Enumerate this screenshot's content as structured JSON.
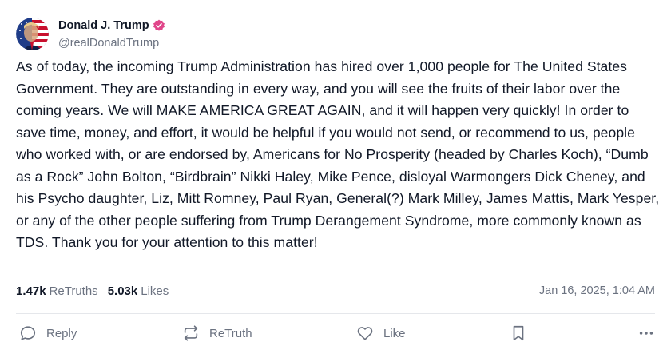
{
  "author": {
    "display_name": "Donald J. Trump",
    "handle": "@realDonaldTrump",
    "verified_color": "#e0468a"
  },
  "post": {
    "text": "As of today, the incoming Trump Administration has hired over 1,000 people for The United States Government. They are outstanding in every way, and you will see the fruits of their labor over the coming years. We will MAKE AMERICA GREAT AGAIN, and it will happen very quickly! In order to save time, money, and effort, it would be helpful if you would not send, or recommend to us, people who worked with, or are endorsed by, Americans for No Prosperity (headed by Charles Koch), “Dumb as a Rock” John Bolton, “Birdbrain” Nikki Haley, Mike Pence, disloyal Warmongers Dick Cheney, and his Psycho daughter, Liz, Mitt Romney, Paul Ryan, General(?) Mark Milley, James Mattis, Mark Yesper, or any of the other people suffering from Trump Derangement Syndrome, more commonly known as TDS. Thank you for your attention to this matter!"
  },
  "stats": {
    "retruths_count": "1.47k",
    "retruths_label": "ReTruths",
    "likes_count": "5.03k",
    "likes_label": "Likes",
    "timestamp": "Jan 16, 2025, 1:04 AM"
  },
  "actions": {
    "reply_label": "Reply",
    "retruth_label": "ReTruth",
    "like_label": "Like"
  },
  "icons": {
    "reply": "speech-bubble-icon",
    "retruth": "repost-arrows-icon",
    "like": "heart-icon",
    "bookmark": "bookmark-icon",
    "more": "ellipsis-icon",
    "verified": "verified-badge-icon"
  }
}
